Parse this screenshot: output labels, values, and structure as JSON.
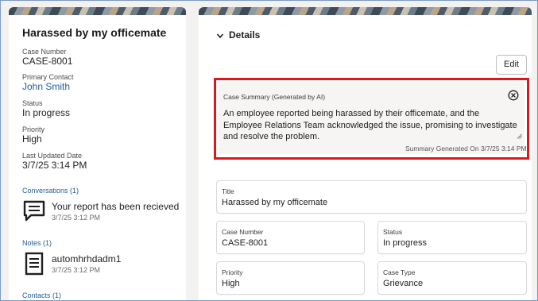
{
  "left": {
    "case_title": "Harassed by my officemate",
    "fields": {
      "case_number_label": "Case Number",
      "case_number": "CASE-8001",
      "primary_contact_label": "Primary Contact",
      "primary_contact": "John Smith",
      "status_label": "Status",
      "status": "In progress",
      "priority_label": "Priority",
      "priority": "High",
      "last_updated_label": "Last Updated Date",
      "last_updated": "3/7/25 3:14 PM"
    },
    "conversations": {
      "heading": "Conversations (1)",
      "items": [
        {
          "title": "Your report has been recieved",
          "date": "3/7/25 3:12 PM",
          "icon": "chat-bubble-icon"
        }
      ]
    },
    "notes": {
      "heading": "Notes (1)",
      "items": [
        {
          "title": "automhrhdadm1",
          "date": "3/7/25 3:12 PM",
          "icon": "note-document-icon"
        }
      ]
    },
    "contacts": {
      "heading": "Contacts (1)"
    }
  },
  "right": {
    "section_title": "Details",
    "edit_label": "Edit",
    "summary": {
      "label": "Case Summary (Generated by AI)",
      "text": "An employee reported being harassed by their officemate, and the Employee Relations Team acknowledged the issue, promising to investigate and resolve the problem.",
      "footer": "Summary Generated On 3/7/25 3:14 PM"
    },
    "fields": {
      "title_label": "Title",
      "title_value": "Harassed by my officemate",
      "case_number_label": "Case Number",
      "case_number_value": "CASE-8001",
      "status_label": "Status",
      "status_value": "In progress",
      "priority_label": "Priority",
      "priority_value": "High",
      "case_type_label": "Case Type",
      "case_type_value": "Grievance"
    }
  },
  "colors": {
    "link": "#1f5c99",
    "highlight_border": "#e0161e",
    "page_background": "#f3f2f0"
  }
}
